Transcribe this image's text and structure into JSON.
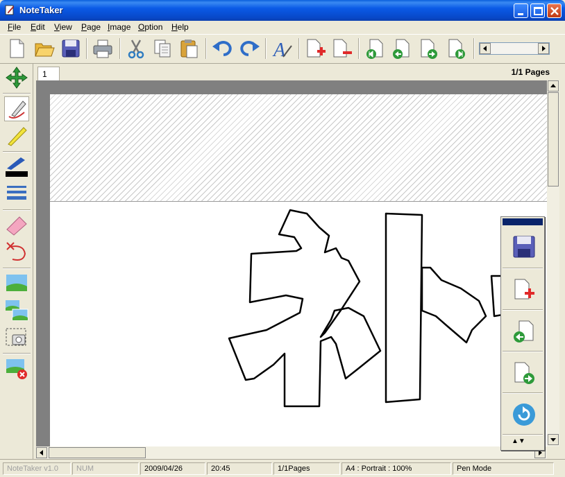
{
  "window": {
    "title": "NoteTaker",
    "accent": "#0a5ae6"
  },
  "menu": [
    {
      "label": "File",
      "key": "F",
      "rest": "ile"
    },
    {
      "label": "Edit",
      "key": "E",
      "rest": "dit"
    },
    {
      "label": "View",
      "key": "V",
      "rest": "iew"
    },
    {
      "label": "Page",
      "key": "P",
      "rest": "age"
    },
    {
      "label": "Image",
      "key": "I",
      "rest": "mage"
    },
    {
      "label": "Option",
      "key": "O",
      "rest": "ption"
    },
    {
      "label": "Help",
      "key": "H",
      "rest": "elp"
    }
  ],
  "toolbar": {
    "icons": [
      "new-file-icon",
      "open-folder-icon",
      "save-icon",
      "print-icon",
      "cut-icon",
      "copy-icon",
      "paste-icon",
      "undo-icon",
      "redo-icon",
      "font-icon",
      "add-page-icon",
      "delete-page-icon",
      "first-page-icon",
      "previous-page-icon",
      "next-page-icon",
      "last-page-icon"
    ]
  },
  "left_tools": [
    "move-icon",
    "pen-icon",
    "highlighter-icon",
    "brush-color-icon",
    "line-width-icon",
    "eraser-icon",
    "lasso-delete-icon",
    "insert-image-icon",
    "image-list-icon",
    "screen-capture-icon",
    "remove-image-icon"
  ],
  "tabs": {
    "current": "1",
    "page_count": "1/1 Pages"
  },
  "float_panel": {
    "icons": [
      "save-icon",
      "add-page-icon",
      "previous-page-icon",
      "next-page-icon",
      "refresh-icon"
    ],
    "arrows": "▲▼"
  },
  "status": {
    "app": "NoteTaker v1.0",
    "num": "NUM",
    "date": "2009/04/26",
    "time": "20:45",
    "pages": "1/1Pages",
    "paper": "A4 : Portrait : 100%",
    "mode": "Pen Mode"
  }
}
